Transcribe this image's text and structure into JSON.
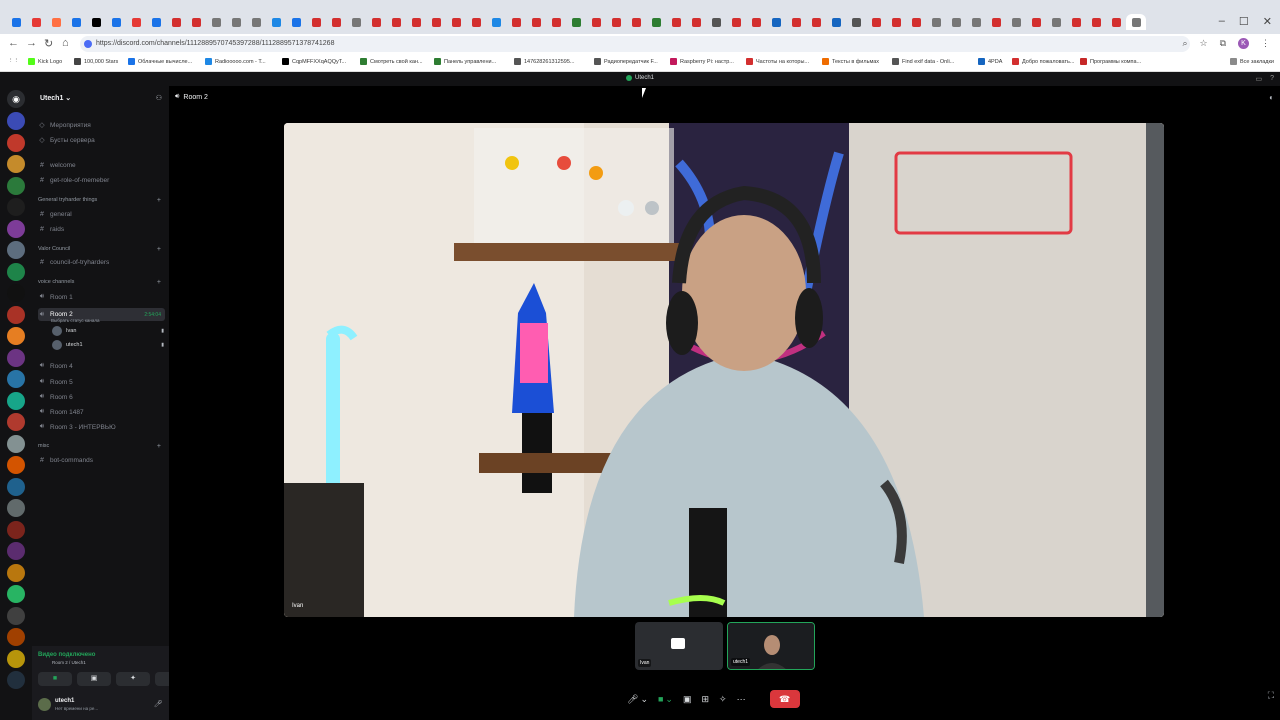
{
  "browser": {
    "url": "https://discord.com/channels/1112889570745397288/1112889571378741268",
    "window_controls": [
      "–",
      "☐",
      "✕"
    ],
    "bookmarks": [
      {
        "label": "Kick Logo",
        "color": "#53fc18"
      },
      {
        "label": "100,000 Stars",
        "color": "#444444"
      },
      {
        "label": "Облачные вычисле...",
        "color": "#1a73e8"
      },
      {
        "label": "Radiooooo.com - T...",
        "color": "#1e88e5"
      },
      {
        "label": "CqpMFFXXqAQQyT...",
        "color": "#000000"
      },
      {
        "label": "Смотреть свой кан...",
        "color": "#2e7d32"
      },
      {
        "label": "Панель управлени...",
        "color": "#2e7d32"
      },
      {
        "label": "147628261312595...",
        "color": "#555555"
      },
      {
        "label": "Радиопередатчик F...",
        "color": "#555555"
      },
      {
        "label": "Raspberry Pi: настр...",
        "color": "#c2185b"
      },
      {
        "label": "Частоты на которы...",
        "color": "#d32f2f"
      },
      {
        "label": "Тексты в фильмах",
        "color": "#ef6c00"
      },
      {
        "label": "Find exif data - Onli...",
        "color": "#555555"
      },
      {
        "label": "4PDA",
        "color": "#1565c0"
      },
      {
        "label": "Добро пожаловать...",
        "color": "#d32f2f"
      },
      {
        "label": "Программы компа...",
        "color": "#c62828"
      }
    ],
    "all_bookmarks": "Все закладки"
  },
  "titlebar": {
    "server": "Utech1"
  },
  "server": {
    "name": "Utech1",
    "items": [
      {
        "type": "item",
        "icon": "calendar-icon",
        "label": "Мероприятия"
      },
      {
        "type": "item",
        "icon": "boost-icon",
        "label": "Бусты сервера"
      },
      {
        "type": "text",
        "label": "welcome"
      },
      {
        "type": "text",
        "label": "get-role-of-memeber"
      },
      {
        "type": "category",
        "label": "General tryharder things"
      },
      {
        "type": "text",
        "label": "general"
      },
      {
        "type": "text",
        "label": "raids"
      },
      {
        "type": "category",
        "label": "Valor Council"
      },
      {
        "type": "text",
        "label": "council-of-tryharders"
      },
      {
        "type": "category",
        "label": "voice channels"
      },
      {
        "type": "voice",
        "label": "Room 1"
      },
      {
        "type": "voice",
        "label": "Room 2",
        "active": true,
        "timer": "2:54:04",
        "sub": "Выбрать статус канала"
      },
      {
        "type": "voice",
        "label": "Room 4"
      },
      {
        "type": "voice",
        "label": "Room 5"
      },
      {
        "type": "voice",
        "label": "Room 6"
      },
      {
        "type": "voice",
        "label": "Room 1487"
      },
      {
        "type": "voice",
        "label": "Room 3 - ИНТЕРВЬЮ"
      },
      {
        "type": "category",
        "label": "misc"
      },
      {
        "type": "text",
        "label": "bot-commands"
      }
    ],
    "voice_users": [
      {
        "name": "Ivan"
      },
      {
        "name": "utech1"
      }
    ]
  },
  "voice_panel": {
    "status": "Видео подключено",
    "sub": "Room 2 / Utech1"
  },
  "user": {
    "name": "utech1",
    "status": "Нет времени на ре..."
  },
  "stage": {
    "room": "Room 2",
    "main_video_label": "Ivan",
    "thumbs": [
      {
        "label": "Ivan"
      },
      {
        "label": "utech1"
      }
    ]
  },
  "colors": {
    "accent_green": "#23a55a",
    "hangup_red": "#da373c",
    "background": "#000000"
  }
}
